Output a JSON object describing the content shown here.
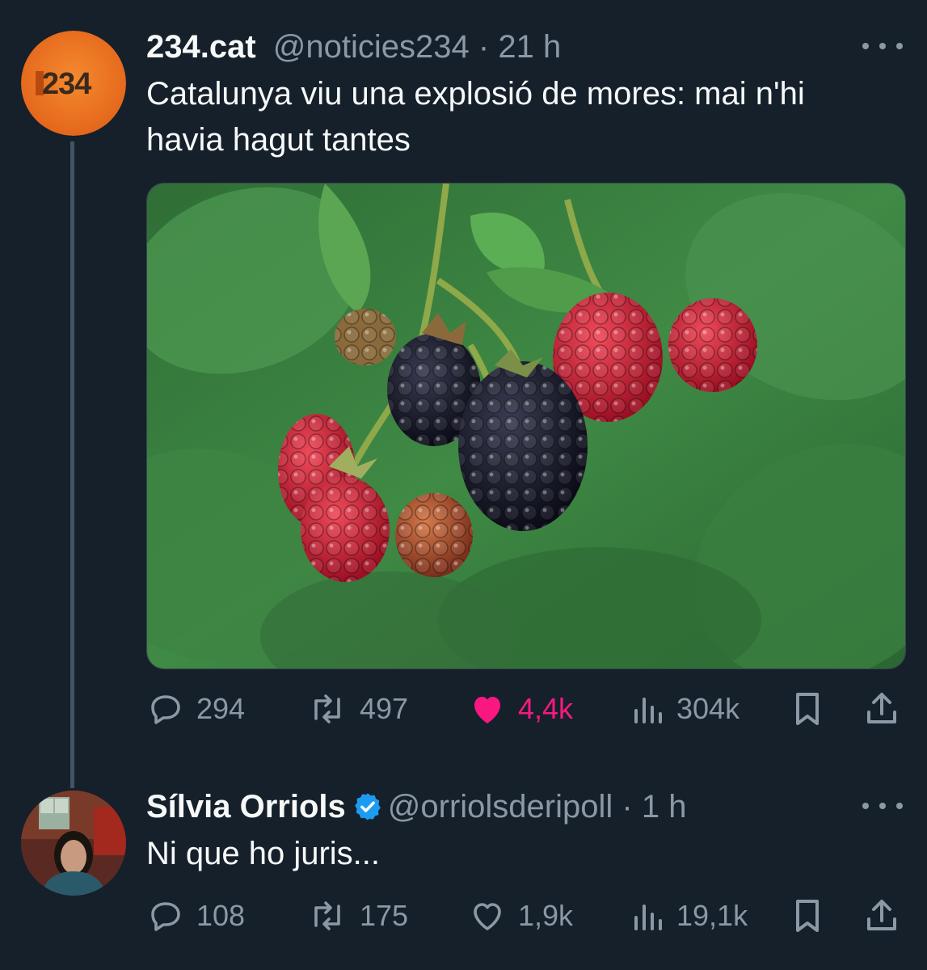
{
  "colors": {
    "background": "#15202b",
    "text_primary": "#f7f9f9",
    "text_secondary": "#8b98a5",
    "like_active": "#f91880",
    "verified": "#1d9bf0",
    "brand_avatar": "#f07a22"
  },
  "tweet1": {
    "avatar_text": "234",
    "name": "234.cat",
    "handle": "@noticies234",
    "separator": "·",
    "time": "21 h",
    "text": "Catalunya viu una explosió de mores: mai n'hi havia hagut tantes",
    "media_icon": "blackberries-photo",
    "actions": {
      "replies": "294",
      "reposts": "497",
      "likes": "4,4k",
      "views": "304k"
    },
    "liked": true
  },
  "tweet2": {
    "name": "Sílvia Orriols",
    "verified": true,
    "handle": "@orriolsderipoll",
    "separator": "·",
    "time": "1 h",
    "text": "Ni que ho juris...",
    "actions": {
      "replies": "108",
      "reposts": "175",
      "likes": "1,9k",
      "views": "19,1k"
    },
    "liked": false
  }
}
